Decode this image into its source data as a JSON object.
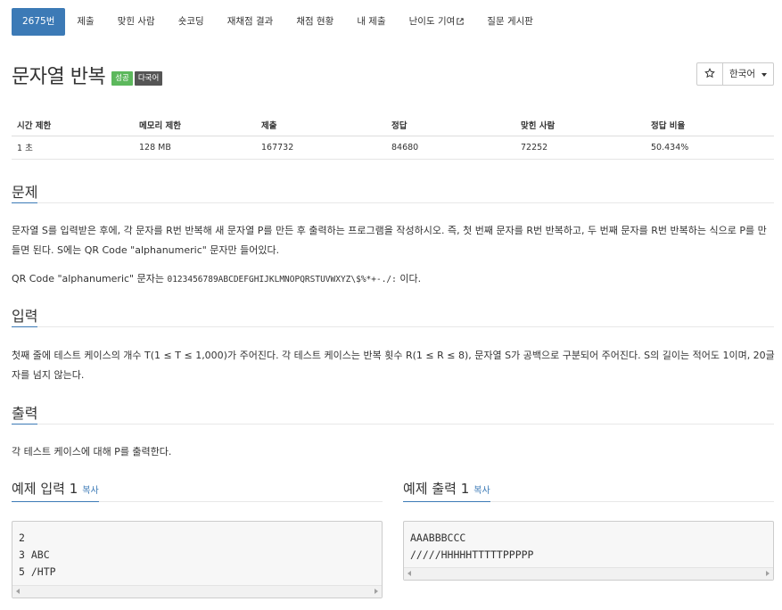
{
  "nav": {
    "items": [
      {
        "label": "2675번",
        "active": true
      },
      {
        "label": "제출"
      },
      {
        "label": "맞힌 사람"
      },
      {
        "label": "숏코딩"
      },
      {
        "label": "재채점 결과"
      },
      {
        "label": "채점 현황"
      },
      {
        "label": "내 제출"
      },
      {
        "label": "난이도 기여",
        "external_icon": "external-link-icon"
      },
      {
        "label": "질문 게시판"
      }
    ]
  },
  "problem": {
    "title": "문자열 반복",
    "badges": {
      "success": "성공",
      "language": "다국어"
    },
    "star_icon": "star-outline-icon",
    "language_select": "한국어"
  },
  "info_table": {
    "headers": [
      "시간 제한",
      "메모리 제한",
      "제출",
      "정답",
      "맞힌 사람",
      "정답 비율"
    ],
    "values": [
      "1 초",
      "128 MB",
      "167732",
      "84680",
      "72252",
      "50.434%"
    ]
  },
  "sections": {
    "description": {
      "heading": "문제",
      "p1": "문자열 S를 입력받은 후에, 각 문자를 R번 반복해 새 문자열 P를 만든 후 출력하는 프로그램을 작성하시오. 즉, 첫 번째 문자를 R번 반복하고, 두 번째 문자를 R번 반복하는 식으로 P를 만들면 된다. S에는 QR Code \"alphanumeric\" 문자만 들어있다.",
      "p2_prefix": "QR Code \"alphanumeric\" 문자는 ",
      "p2_code": "0123456789ABCDEFGHIJKLMNOPQRSTUVWXYZ\\$%*+-./:",
      "p2_suffix": " 이다."
    },
    "input": {
      "heading": "입력",
      "text": "첫째 줄에 테스트 케이스의 개수 T(1 ≤ T ≤ 1,000)가 주어진다. 각 테스트 케이스는 반복 횟수 R(1 ≤ R ≤ 8), 문자열 S가 공백으로 구분되어 주어진다. S의 길이는 적어도 1이며, 20글자를 넘지 않는다."
    },
    "output": {
      "heading": "출력",
      "text": "각 테스트 케이스에 대해 P를 출력한다."
    }
  },
  "samples": {
    "input": {
      "heading": "예제 입력 1",
      "copy": "복사",
      "lines": [
        "2",
        "3 ABC",
        "5 /HTP"
      ]
    },
    "output": {
      "heading": "예제 출력 1",
      "copy": "복사",
      "lines": [
        "AAABBBCCC",
        "/////HHHHHTTTTTPPPPP"
      ]
    }
  },
  "colors": {
    "accent": "#3c7ab6",
    "success": "#5cb85c",
    "language_badge": "#555555"
  }
}
